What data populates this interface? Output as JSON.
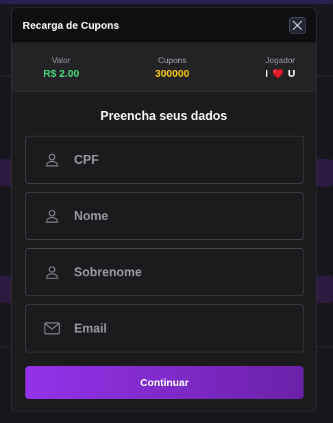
{
  "modal": {
    "title": "Recarga de Cupons",
    "close_icon": "close-icon"
  },
  "summary": {
    "valor": {
      "label": "Valor",
      "value": "R$ 2.00",
      "color": "#4ade80"
    },
    "cupons": {
      "label": "Cupons",
      "value": "300000",
      "color": "#facc15"
    },
    "jogador": {
      "label": "Jogador",
      "value_left": "I",
      "value_right": "U",
      "icon": "heart-icon"
    }
  },
  "form": {
    "title": "Preencha seus dados",
    "fields": [
      {
        "name": "cpf",
        "placeholder": "CPF",
        "icon": "user-icon"
      },
      {
        "name": "nome",
        "placeholder": "Nome",
        "icon": "user-icon"
      },
      {
        "name": "sobrenome",
        "placeholder": "Sobrenome",
        "icon": "user-icon"
      },
      {
        "name": "email",
        "placeholder": "Email",
        "icon": "mail-icon"
      }
    ],
    "submit_label": "Continuar"
  },
  "colors": {
    "accent_start": "#9333ea",
    "accent_end": "#6b21a8"
  }
}
